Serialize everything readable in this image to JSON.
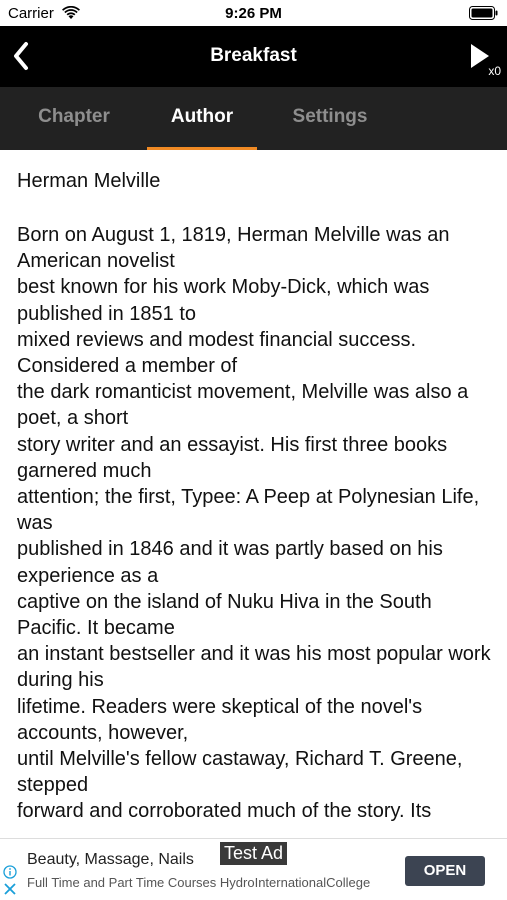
{
  "status_bar": {
    "carrier": "Carrier",
    "time": "9:26 PM",
    "icons": [
      "wifi-icon",
      "battery-icon"
    ]
  },
  "nav": {
    "title": "Breakfast",
    "back_icon": "chevron-left-icon",
    "play_icon": "play-icon",
    "speed": "x0"
  },
  "tabs": [
    {
      "label": "Chapter",
      "active": false
    },
    {
      "label": "Author",
      "active": true
    },
    {
      "label": "Settings",
      "active": false
    }
  ],
  "content": {
    "author_name": "Herman Melville",
    "bio": "Born on August 1, 1819, Herman Melville was an American novelist\nbest known for his work Moby-Dick, which was published in 1851 to\nmixed reviews and modest financial success. Considered a member of\nthe dark romanticist movement, Melville was also a poet, a short\nstory writer and an essayist. His first three books garnered much\nattention; the first, Typee: A Peep at Polynesian Life, was\npublished in 1846 and it was partly based on his experience as a\ncaptive on the island of Nuku Hiva in the South Pacific. It became\nan instant bestseller and it was his most popular work during his\nlifetime. Readers were skeptical of the novel's accounts, however,\nuntil Melville's fellow castaway, Richard T. Greene, stepped\nforward and corroborated much of the story. Its"
  },
  "ad": {
    "label": "Test Ad",
    "title": "Beauty, Massage, Nails",
    "subtitle": "Full Time and Part Time Courses HydroInternationalCollege",
    "button": "OPEN",
    "icons": [
      "info-icon",
      "close-icon"
    ]
  },
  "colors": {
    "nav_background": "#000000",
    "tab_background": "#222222",
    "tab_accent": "#f08a24",
    "ad_button": "#3c4452",
    "ad_icon": "#1a9fd9"
  }
}
